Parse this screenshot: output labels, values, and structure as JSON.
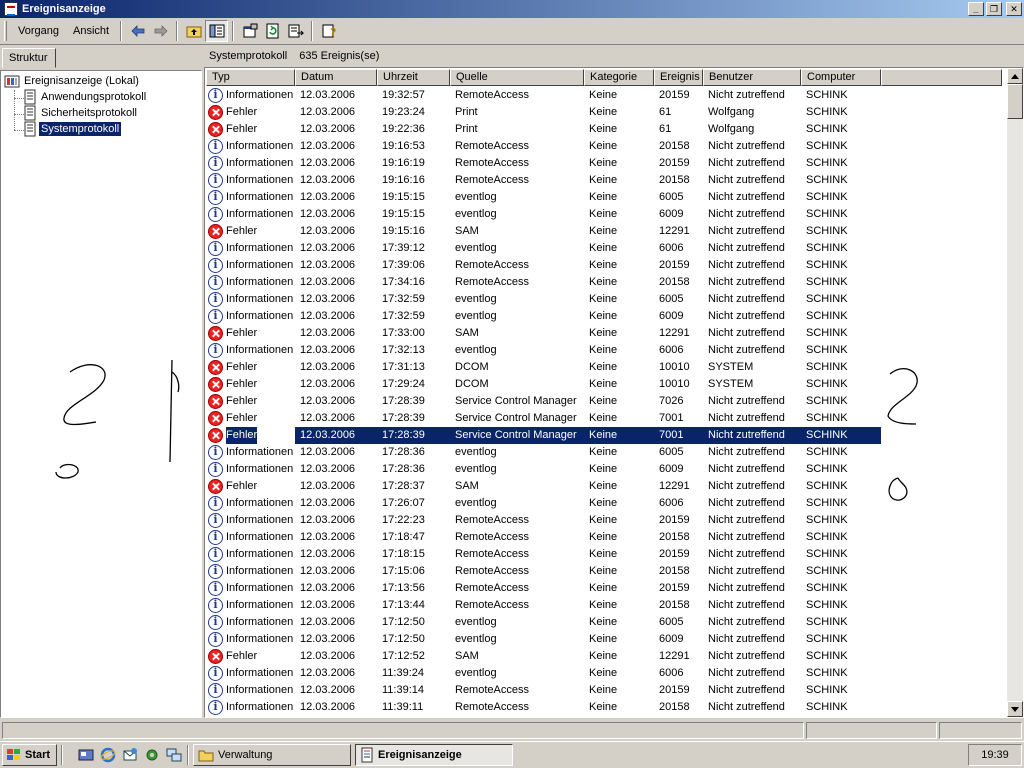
{
  "window": {
    "title": "Ereignisanzeige"
  },
  "menu": {
    "items": [
      {
        "label": "Vorgang",
        "key": "o"
      },
      {
        "label": "Ansicht",
        "key": "A"
      }
    ]
  },
  "toolbar": {
    "icons": [
      "back-icon",
      "forward-icon",
      "up-folder-icon",
      "show-hide-tree-icon",
      "properties-icon",
      "refresh-icon",
      "export-list-icon",
      "help-icon"
    ]
  },
  "left_pane": {
    "tab_label": "Struktur",
    "tree": [
      {
        "label": "Ereignisanzeige (Lokal)",
        "level": 0,
        "selected": false
      },
      {
        "label": "Anwendungsprotokoll",
        "level": 1,
        "selected": false
      },
      {
        "label": "Sicherheitsprotokoll",
        "level": 1,
        "selected": false
      },
      {
        "label": "Systemprotokoll",
        "level": 1,
        "selected": true
      }
    ]
  },
  "right_pane": {
    "log_name": "Systemprotokoll",
    "count_text": "635 Ereignis(se)",
    "columns": [
      "Typ",
      "Datum",
      "Uhrzeit",
      "Quelle",
      "Kategorie",
      "Ereignis",
      "Benutzer",
      "Computer"
    ],
    "selected_row": 20,
    "rows": [
      [
        "info",
        "Informationen",
        "12.03.2006",
        "19:32:57",
        "RemoteAccess",
        "Keine",
        "20159",
        "Nicht zutreffend",
        "SCHINK"
      ],
      [
        "error",
        "Fehler",
        "12.03.2006",
        "19:23:24",
        "Print",
        "Keine",
        "61",
        "Wolfgang",
        "SCHINK"
      ],
      [
        "error",
        "Fehler",
        "12.03.2006",
        "19:22:36",
        "Print",
        "Keine",
        "61",
        "Wolfgang",
        "SCHINK"
      ],
      [
        "info",
        "Informationen",
        "12.03.2006",
        "19:16:53",
        "RemoteAccess",
        "Keine",
        "20158",
        "Nicht zutreffend",
        "SCHINK"
      ],
      [
        "info",
        "Informationen",
        "12.03.2006",
        "19:16:19",
        "RemoteAccess",
        "Keine",
        "20159",
        "Nicht zutreffend",
        "SCHINK"
      ],
      [
        "info",
        "Informationen",
        "12.03.2006",
        "19:16:16",
        "RemoteAccess",
        "Keine",
        "20158",
        "Nicht zutreffend",
        "SCHINK"
      ],
      [
        "info",
        "Informationen",
        "12.03.2006",
        "19:15:15",
        "eventlog",
        "Keine",
        "6005",
        "Nicht zutreffend",
        "SCHINK"
      ],
      [
        "info",
        "Informationen",
        "12.03.2006",
        "19:15:15",
        "eventlog",
        "Keine",
        "6009",
        "Nicht zutreffend",
        "SCHINK"
      ],
      [
        "error",
        "Fehler",
        "12.03.2006",
        "19:15:16",
        "SAM",
        "Keine",
        "12291",
        "Nicht zutreffend",
        "SCHINK"
      ],
      [
        "info",
        "Informationen",
        "12.03.2006",
        "17:39:12",
        "eventlog",
        "Keine",
        "6006",
        "Nicht zutreffend",
        "SCHINK"
      ],
      [
        "info",
        "Informationen",
        "12.03.2006",
        "17:39:06",
        "RemoteAccess",
        "Keine",
        "20159",
        "Nicht zutreffend",
        "SCHINK"
      ],
      [
        "info",
        "Informationen",
        "12.03.2006",
        "17:34:16",
        "RemoteAccess",
        "Keine",
        "20158",
        "Nicht zutreffend",
        "SCHINK"
      ],
      [
        "info",
        "Informationen",
        "12.03.2006",
        "17:32:59",
        "eventlog",
        "Keine",
        "6005",
        "Nicht zutreffend",
        "SCHINK"
      ],
      [
        "info",
        "Informationen",
        "12.03.2006",
        "17:32:59",
        "eventlog",
        "Keine",
        "6009",
        "Nicht zutreffend",
        "SCHINK"
      ],
      [
        "error",
        "Fehler",
        "12.03.2006",
        "17:33:00",
        "SAM",
        "Keine",
        "12291",
        "Nicht zutreffend",
        "SCHINK"
      ],
      [
        "info",
        "Informationen",
        "12.03.2006",
        "17:32:13",
        "eventlog",
        "Keine",
        "6006",
        "Nicht zutreffend",
        "SCHINK"
      ],
      [
        "error",
        "Fehler",
        "12.03.2006",
        "17:31:13",
        "DCOM",
        "Keine",
        "10010",
        "SYSTEM",
        "SCHINK"
      ],
      [
        "error",
        "Fehler",
        "12.03.2006",
        "17:29:24",
        "DCOM",
        "Keine",
        "10010",
        "SYSTEM",
        "SCHINK"
      ],
      [
        "error",
        "Fehler",
        "12.03.2006",
        "17:28:39",
        "Service Control Manager",
        "Keine",
        "7026",
        "Nicht zutreffend",
        "SCHINK"
      ],
      [
        "error",
        "Fehler",
        "12.03.2006",
        "17:28:39",
        "Service Control Manager",
        "Keine",
        "7001",
        "Nicht zutreffend",
        "SCHINK"
      ],
      [
        "error",
        "Fehler",
        "12.03.2006",
        "17:28:39",
        "Service Control Manager",
        "Keine",
        "7001",
        "Nicht zutreffend",
        "SCHINK"
      ],
      [
        "info",
        "Informationen",
        "12.03.2006",
        "17:28:36",
        "eventlog",
        "Keine",
        "6005",
        "Nicht zutreffend",
        "SCHINK"
      ],
      [
        "info",
        "Informationen",
        "12.03.2006",
        "17:28:36",
        "eventlog",
        "Keine",
        "6009",
        "Nicht zutreffend",
        "SCHINK"
      ],
      [
        "error",
        "Fehler",
        "12.03.2006",
        "17:28:37",
        "SAM",
        "Keine",
        "12291",
        "Nicht zutreffend",
        "SCHINK"
      ],
      [
        "info",
        "Informationen",
        "12.03.2006",
        "17:26:07",
        "eventlog",
        "Keine",
        "6006",
        "Nicht zutreffend",
        "SCHINK"
      ],
      [
        "info",
        "Informationen",
        "12.03.2006",
        "17:22:23",
        "RemoteAccess",
        "Keine",
        "20159",
        "Nicht zutreffend",
        "SCHINK"
      ],
      [
        "info",
        "Informationen",
        "12.03.2006",
        "17:18:47",
        "RemoteAccess",
        "Keine",
        "20158",
        "Nicht zutreffend",
        "SCHINK"
      ],
      [
        "info",
        "Informationen",
        "12.03.2006",
        "17:18:15",
        "RemoteAccess",
        "Keine",
        "20159",
        "Nicht zutreffend",
        "SCHINK"
      ],
      [
        "info",
        "Informationen",
        "12.03.2006",
        "17:15:06",
        "RemoteAccess",
        "Keine",
        "20158",
        "Nicht zutreffend",
        "SCHINK"
      ],
      [
        "info",
        "Informationen",
        "12.03.2006",
        "17:13:56",
        "RemoteAccess",
        "Keine",
        "20159",
        "Nicht zutreffend",
        "SCHINK"
      ],
      [
        "info",
        "Informationen",
        "12.03.2006",
        "17:13:44",
        "RemoteAccess",
        "Keine",
        "20158",
        "Nicht zutreffend",
        "SCHINK"
      ],
      [
        "info",
        "Informationen",
        "12.03.2006",
        "17:12:50",
        "eventlog",
        "Keine",
        "6005",
        "Nicht zutreffend",
        "SCHINK"
      ],
      [
        "info",
        "Informationen",
        "12.03.2006",
        "17:12:50",
        "eventlog",
        "Keine",
        "6009",
        "Nicht zutreffend",
        "SCHINK"
      ],
      [
        "error",
        "Fehler",
        "12.03.2006",
        "17:12:52",
        "SAM",
        "Keine",
        "12291",
        "Nicht zutreffend",
        "SCHINK"
      ],
      [
        "info",
        "Informationen",
        "12.03.2006",
        "11:39:24",
        "eventlog",
        "Keine",
        "6006",
        "Nicht zutreffend",
        "SCHINK"
      ],
      [
        "info",
        "Informationen",
        "12.03.2006",
        "11:39:14",
        "RemoteAccess",
        "Keine",
        "20159",
        "Nicht zutreffend",
        "SCHINK"
      ],
      [
        "info",
        "Informationen",
        "12.03.2006",
        "11:39:11",
        "RemoteAccess",
        "Keine",
        "20158",
        "Nicht zutreffend",
        "SCHINK"
      ]
    ]
  },
  "taskbar": {
    "start_label": "Start",
    "quick_launch": [
      "show-desktop-icon",
      "internet-explorer-icon",
      "outlook-express-icon",
      "settings-icon",
      "network-icon"
    ],
    "tasks": [
      {
        "label": "Verwaltung",
        "active": false
      },
      {
        "label": "Ereignisanzeige",
        "active": true
      }
    ],
    "clock": "19:39"
  },
  "colors": {
    "titlebar_start": "#0a246a",
    "titlebar_end": "#a6caf0",
    "selection": "#0a246a",
    "error": "#e22222",
    "info": "#223a8c",
    "face": "#d4d0c8"
  }
}
